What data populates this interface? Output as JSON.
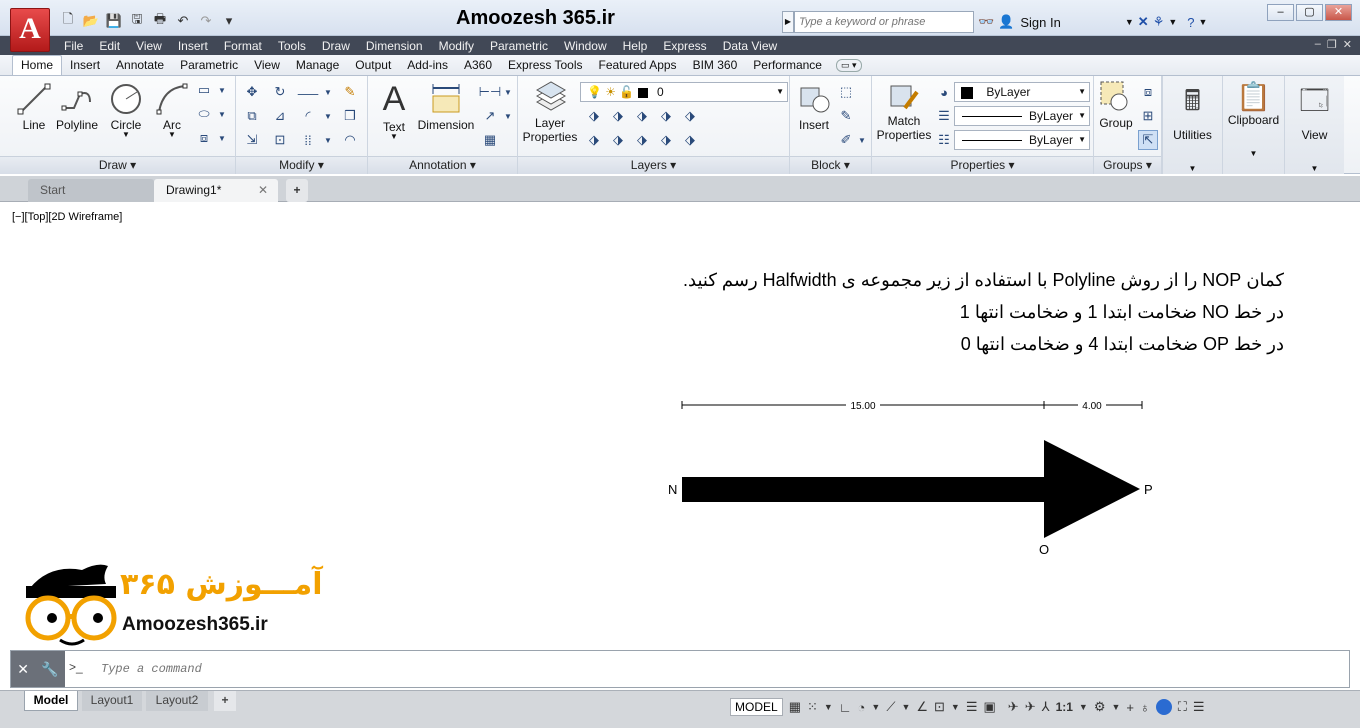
{
  "window": {
    "title": "Amoozesh 365.ir",
    "app_button": "A",
    "search_placeholder": "Type a keyword or phrase",
    "sign_in": "Sign In",
    "controls": [
      "–",
      "▢",
      "✕"
    ]
  },
  "menubar": {
    "items": [
      "File",
      "Edit",
      "View",
      "Insert",
      "Format",
      "Tools",
      "Draw",
      "Dimension",
      "Modify",
      "Parametric",
      "Window",
      "Help",
      "Express",
      "Data View"
    ]
  },
  "ribbon_tabs": {
    "items": [
      "Home",
      "Insert",
      "Annotate",
      "Parametric",
      "View",
      "Manage",
      "Output",
      "Add-ins",
      "A360",
      "Express Tools",
      "Featured Apps",
      "BIM 360",
      "Performance"
    ],
    "active": "Home"
  },
  "panels": {
    "draw": {
      "title": "Draw",
      "line": "Line",
      "polyline": "Polyline",
      "circle": "Circle",
      "arc": "Arc"
    },
    "modify": {
      "title": "Modify"
    },
    "annotation": {
      "title": "Annotation",
      "text": "Text",
      "dimension": "Dimension"
    },
    "layers": {
      "title": "Layers",
      "layer_properties_1": "Layer",
      "layer_properties_2": "Properties",
      "current_layer": "0"
    },
    "block": {
      "title": "Block",
      "insert": "Insert"
    },
    "properties": {
      "title": "Properties",
      "match_1": "Match",
      "match_2": "Properties",
      "color": "ByLayer",
      "linetype": "ByLayer",
      "lineweight": "ByLayer"
    },
    "groups": {
      "title": "Groups",
      "group": "Group"
    },
    "utilities": "Utilities",
    "clipboard": "Clipboard",
    "view": "View"
  },
  "file_tabs": {
    "start": "Start",
    "drawing": "Drawing1*",
    "close": "✕",
    "add": "+"
  },
  "viewport": {
    "label": "[−][Top][2D Wireframe]"
  },
  "instructions": {
    "line1": "کمان NOP را از روش Polyline با استفاده از زیر مجموعه ی Halfwidth  رسم کنید.",
    "line2": "در خط NO ضخامت ابتدا 1 و ضخامت انتها 1",
    "line3": "در خط OP ضخامت ابتدا 4 و ضخامت انتها 0"
  },
  "drawing": {
    "dim1": "15.00",
    "dim2": "4.00",
    "point_n": "N",
    "point_o": "O",
    "point_p": "P"
  },
  "logo": {
    "text_fa": "آمـــوزش ۳۶۵",
    "url": "Amoozesh365.ir"
  },
  "command": {
    "placeholder": "Type a command",
    "prompt": ">_"
  },
  "status": {
    "layout_tabs": [
      "Model",
      "Layout1",
      "Layout2"
    ],
    "add": "+",
    "model_btn": "MODEL",
    "scale": "1:1"
  }
}
